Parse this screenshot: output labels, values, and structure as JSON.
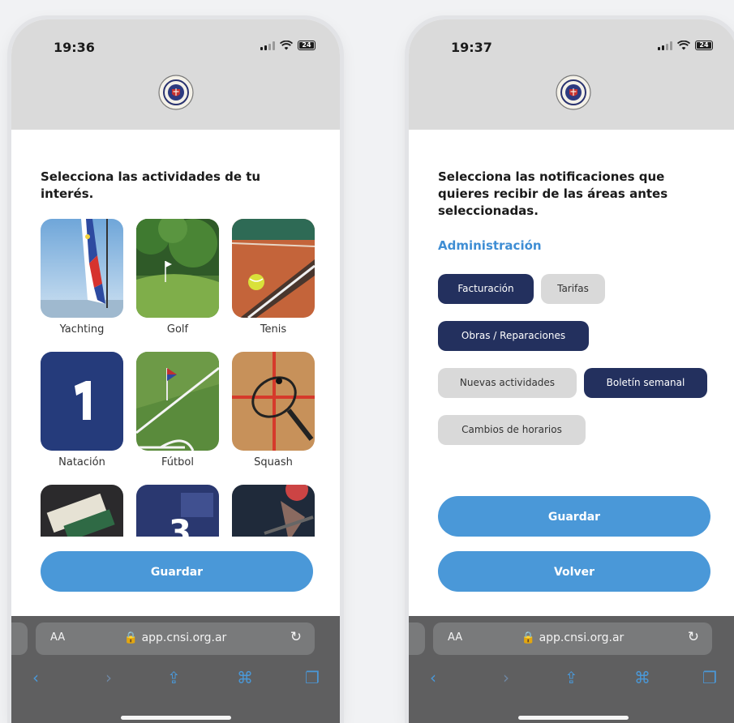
{
  "left_screen": {
    "time": "19:36",
    "battery": "24",
    "heading": "Selecciona las actividades de tu\ninterés.",
    "activities": [
      {
        "label": "Yachting",
        "image": "sailboat-photo"
      },
      {
        "label": "Golf",
        "image": "golf-course-photo"
      },
      {
        "label": "Tenis",
        "image": "tennis-court-photo"
      },
      {
        "label": "Natación",
        "image": "swimming-lane-1-photo"
      },
      {
        "label": "Fútbol",
        "image": "football-corner-photo"
      },
      {
        "label": "Squash",
        "image": "squash-racket-photo"
      },
      {
        "label": "",
        "image": "board-game-photo"
      },
      {
        "label": "",
        "image": "number-3-photo"
      },
      {
        "label": "",
        "image": "gym-photo"
      }
    ],
    "save_label": "Guardar",
    "browser": {
      "aa": "AA",
      "url": "app.cnsi.org.ar"
    }
  },
  "right_screen": {
    "time": "19:37",
    "battery": "24",
    "heading": "Selecciona las notificaciones que\nquieres recibir de las áreas antes\nseleccionadas.",
    "section_title": "Administración",
    "chips": [
      {
        "label": "Facturación",
        "selected": true
      },
      {
        "label": "Tarifas",
        "selected": false
      },
      {
        "label": "Obras / Reparaciones",
        "selected": true
      },
      {
        "label": "Nuevas actividades",
        "selected": false
      },
      {
        "label": "Boletín semanal",
        "selected": true
      },
      {
        "label": "Cambios de horarios",
        "selected": false
      }
    ],
    "save_label": "Guardar",
    "back_label": "Volver",
    "browser": {
      "aa": "AA",
      "url": "app.cnsi.org.ar"
    }
  },
  "colors": {
    "accent": "#4a98d8",
    "chip_selected": "#23305e",
    "chip_unselected": "#d9d9d9",
    "header": "#dadada",
    "browser_bar": "#5f5f60"
  },
  "icons": [
    "signal-icon",
    "wifi-icon",
    "battery-icon",
    "club-logo",
    "lock-icon",
    "reload-icon",
    "back-icon",
    "forward-icon",
    "share-icon",
    "bookmarks-icon",
    "tabs-icon"
  ]
}
